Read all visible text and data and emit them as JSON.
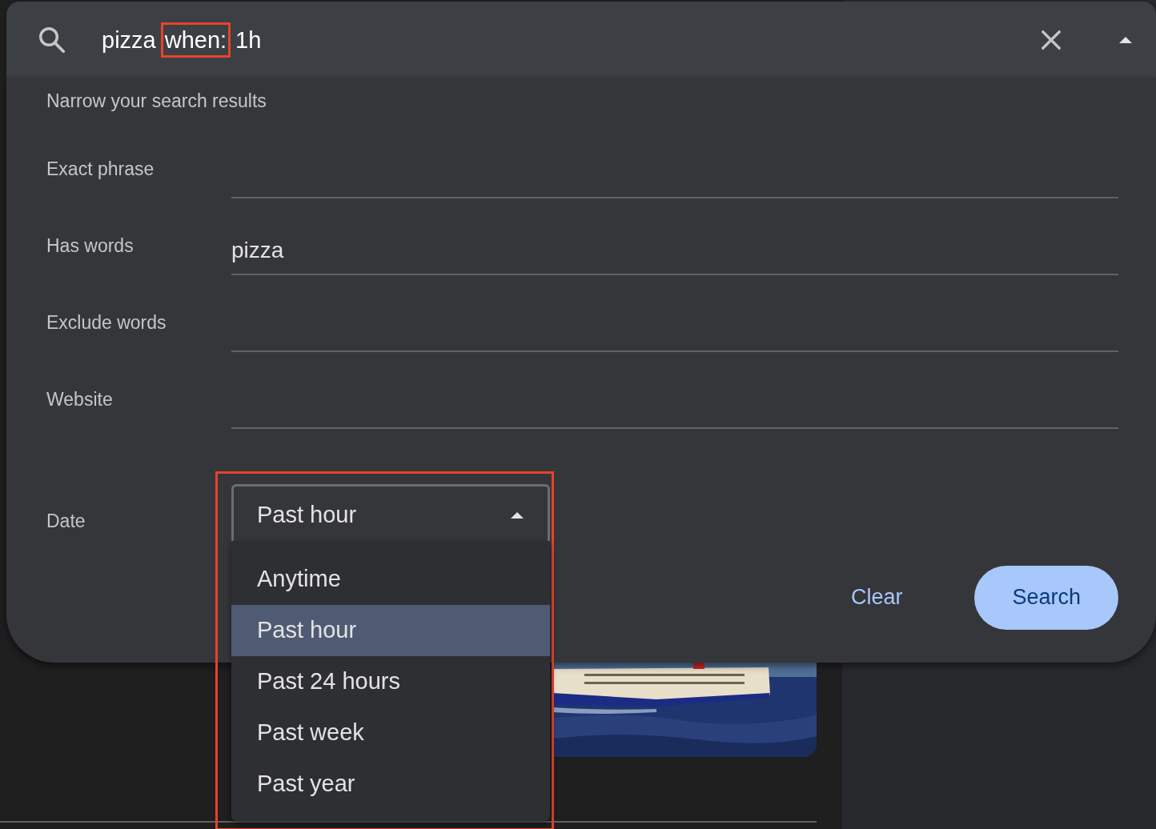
{
  "search_bar": {
    "query_parts": [
      {
        "text": "pizza",
        "highlighted": false
      },
      {
        "text": "when:",
        "highlighted": true
      },
      {
        "text": "1h",
        "highlighted": false
      }
    ],
    "expanded": true
  },
  "panel": {
    "title": "Narrow your search results",
    "fields": [
      {
        "label": "Exact phrase"
      },
      {
        "label": "Has words",
        "value": "pizza"
      },
      {
        "label": "Exclude words"
      },
      {
        "label": "Website"
      }
    ],
    "date": {
      "label": "Date",
      "value": "Past hour",
      "highlighted": true,
      "expanded": true,
      "options": [
        {
          "label": "Anytime",
          "selected": false
        },
        {
          "label": "Past hour",
          "selected": true
        },
        {
          "label": "Past 24 hours",
          "selected": false
        },
        {
          "label": "Past week",
          "selected": false
        },
        {
          "label": "Past year",
          "selected": false
        }
      ]
    },
    "buttons": [
      {
        "label": "Clear",
        "kind": "text"
      },
      {
        "label": "Search",
        "kind": "filled"
      }
    ]
  }
}
